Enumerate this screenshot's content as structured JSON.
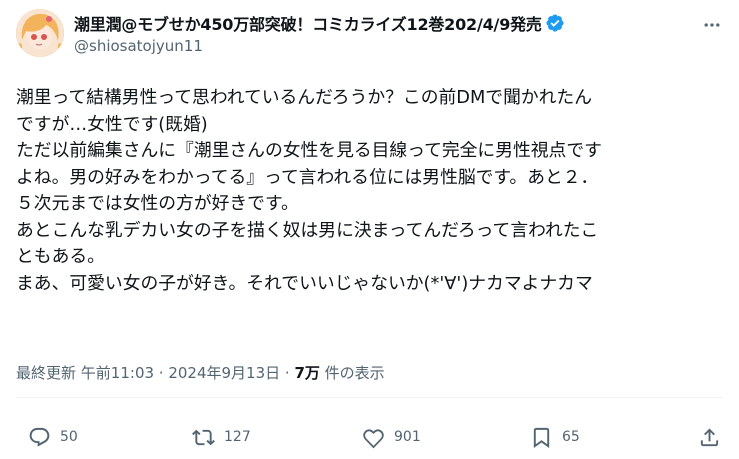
{
  "author": {
    "display_name": "潮里潤@モブせか450万部突破！コミカライズ12巻202/4/9発売",
    "handle": "@shiosatojyun11",
    "verified": true
  },
  "tweet": {
    "lines": [
      "潮里って結構男性って思われているんだろうか？この前DMで聞かれたん",
      "ですが…女性です(既婚)",
      "ただ以前編集さんに『潮里さんの女性を見る目線って完全に男性視点です",
      "よね。男の好みをわかってる』って言われる位には男性脳です。あと２．",
      "５次元までは女性の方が好きです。",
      "あとこんな乳デカい女の子を描く奴は男に決まってんだろって言われたこ",
      "ともある。",
      "まあ、可愛い女の子が好き。それでいいじゃないか(*'∀')ナカマよナカマ"
    ]
  },
  "meta": {
    "label": "最終更新",
    "time": "午前11:03",
    "sep": " · ",
    "date": "2024年9月13日",
    "views_count": "7万",
    "views_label": " 件の表示"
  },
  "actions": {
    "replies": "50",
    "reposts": "127",
    "likes": "901",
    "bookmarks": "65"
  },
  "colors": {
    "text": "#0f1419",
    "secondary": "#536471",
    "verified": "#1d9bf0",
    "divider": "#eff3f4"
  },
  "icons": [
    "more-icon",
    "verified-badge-icon",
    "reply-icon",
    "repost-icon",
    "like-icon",
    "bookmark-icon",
    "share-icon"
  ]
}
